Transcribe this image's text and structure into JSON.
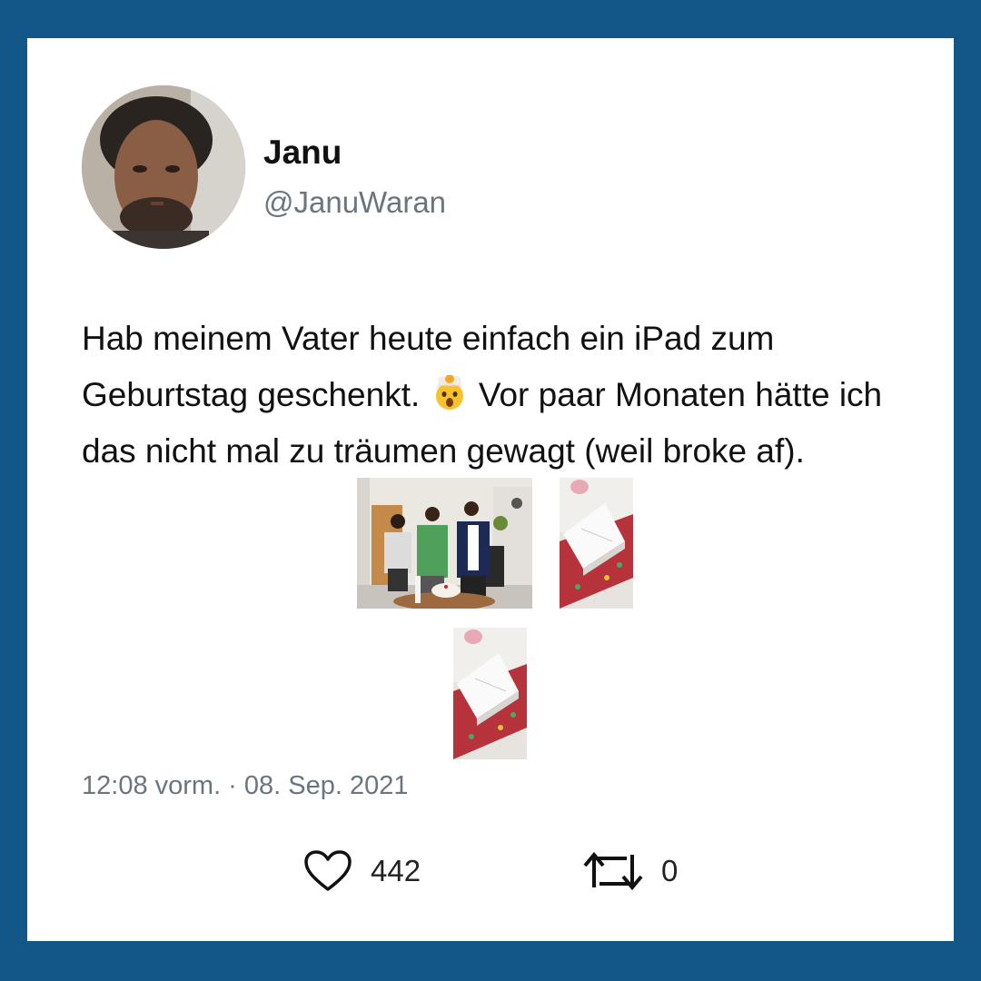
{
  "colors": {
    "frame_background": "#125788",
    "card_background": "#ffffff",
    "secondary_text": "#6b7580",
    "primary_text": "#111111"
  },
  "author": {
    "name": "Janu",
    "handle": "@JanuWaran",
    "avatar_icon": "profile-photo"
  },
  "tweet": {
    "text_part1": "Hab meinem Vater heute einfach ein iPad zum Geburtstag geschenkt.",
    "emoji_icon": "exploding-head-emoji",
    "text_part2": "Vor paar Monaten hätte ich das nicht mal zu träumen gewagt (weil broke af).",
    "photos": [
      {
        "subject": "family-birthday-photo"
      },
      {
        "subject": "ipad-box-photo"
      },
      {
        "subject": "ipad-box-photo"
      }
    ],
    "timestamp": "12:08 vorm. · 08. Sep. 2021"
  },
  "stats": {
    "likes": "442",
    "likes_icon": "heart-icon",
    "retweets": "0",
    "retweets_icon": "retweet-icon"
  }
}
